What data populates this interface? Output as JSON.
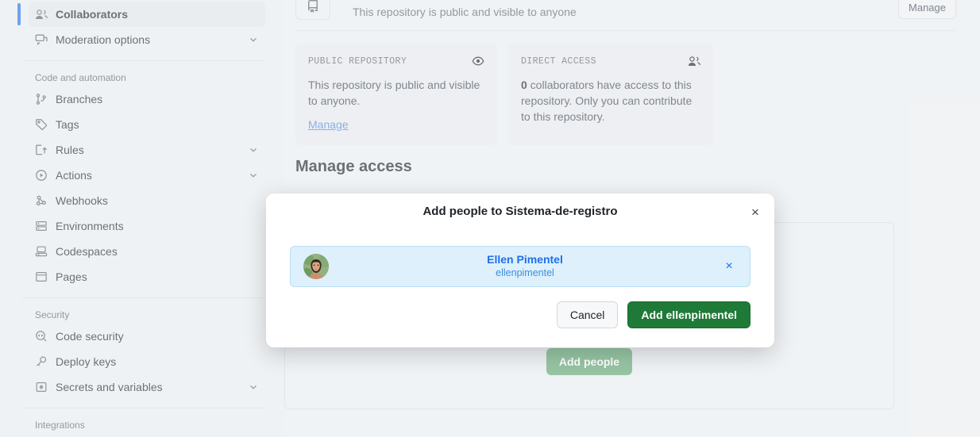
{
  "sidebar": {
    "groups": [
      {
        "title": null,
        "items": [
          {
            "label": "Collaborators",
            "icon": "people-icon",
            "active": true,
            "chevron": false
          },
          {
            "label": "Moderation options",
            "icon": "comment-discussion-icon",
            "active": false,
            "chevron": true
          }
        ]
      },
      {
        "title": "Code and automation",
        "items": [
          {
            "label": "Branches",
            "icon": "git-branch-icon",
            "active": false,
            "chevron": false
          },
          {
            "label": "Tags",
            "icon": "tag-icon",
            "active": false,
            "chevron": false
          },
          {
            "label": "Rules",
            "icon": "rules-icon",
            "active": false,
            "chevron": true
          },
          {
            "label": "Actions",
            "icon": "play-circle-icon",
            "active": false,
            "chevron": true
          },
          {
            "label": "Webhooks",
            "icon": "webhook-icon",
            "active": false,
            "chevron": false
          },
          {
            "label": "Environments",
            "icon": "server-icon",
            "active": false,
            "chevron": false
          },
          {
            "label": "Codespaces",
            "icon": "codespaces-icon",
            "active": false,
            "chevron": false
          },
          {
            "label": "Pages",
            "icon": "browser-icon",
            "active": false,
            "chevron": false
          }
        ]
      },
      {
        "title": "Security",
        "items": [
          {
            "label": "Code security",
            "icon": "code-scan-icon",
            "active": false,
            "chevron": false
          },
          {
            "label": "Deploy keys",
            "icon": "key-icon",
            "active": false,
            "chevron": false
          },
          {
            "label": "Secrets and variables",
            "icon": "asterisk-key-icon",
            "active": false,
            "chevron": true
          }
        ]
      },
      {
        "title": "Integrations",
        "items": []
      }
    ]
  },
  "main": {
    "visibility_row": {
      "text": "This repository is public and visible to anyone",
      "manage_label": "Manage",
      "icon": "repo-icon"
    },
    "cards": [
      {
        "eyebrow": "PUBLIC REPOSITORY",
        "icon": "eye-icon",
        "body": "This repository is public and visible to anyone.",
        "link": "Manage"
      },
      {
        "eyebrow": "DIRECT ACCESS",
        "icon": "people-icon",
        "body_strong": "0",
        "body": " collaborators have access to this repository. Only you can contribute to this repository.",
        "link": null
      }
    ],
    "section_heading": "Manage access",
    "add_people_label": "Add people"
  },
  "modal": {
    "title": "Add people to Sistema-de-registro",
    "close_label": "×",
    "selected_person": {
      "name": "Ellen Pimentel",
      "login": "ellenpimentel",
      "remove_label": "×",
      "avatar": "user-avatar"
    },
    "cancel_label": "Cancel",
    "confirm_label": "Add ellenpimentel"
  },
  "colors": {
    "accent_blue": "#1f6feb",
    "success_green": "#1f7a37",
    "muted_green": "#5fa672",
    "chip_background": "#ddf0fb",
    "sidebar_background": "#e7ebee",
    "page_background": "#e9edf0"
  }
}
